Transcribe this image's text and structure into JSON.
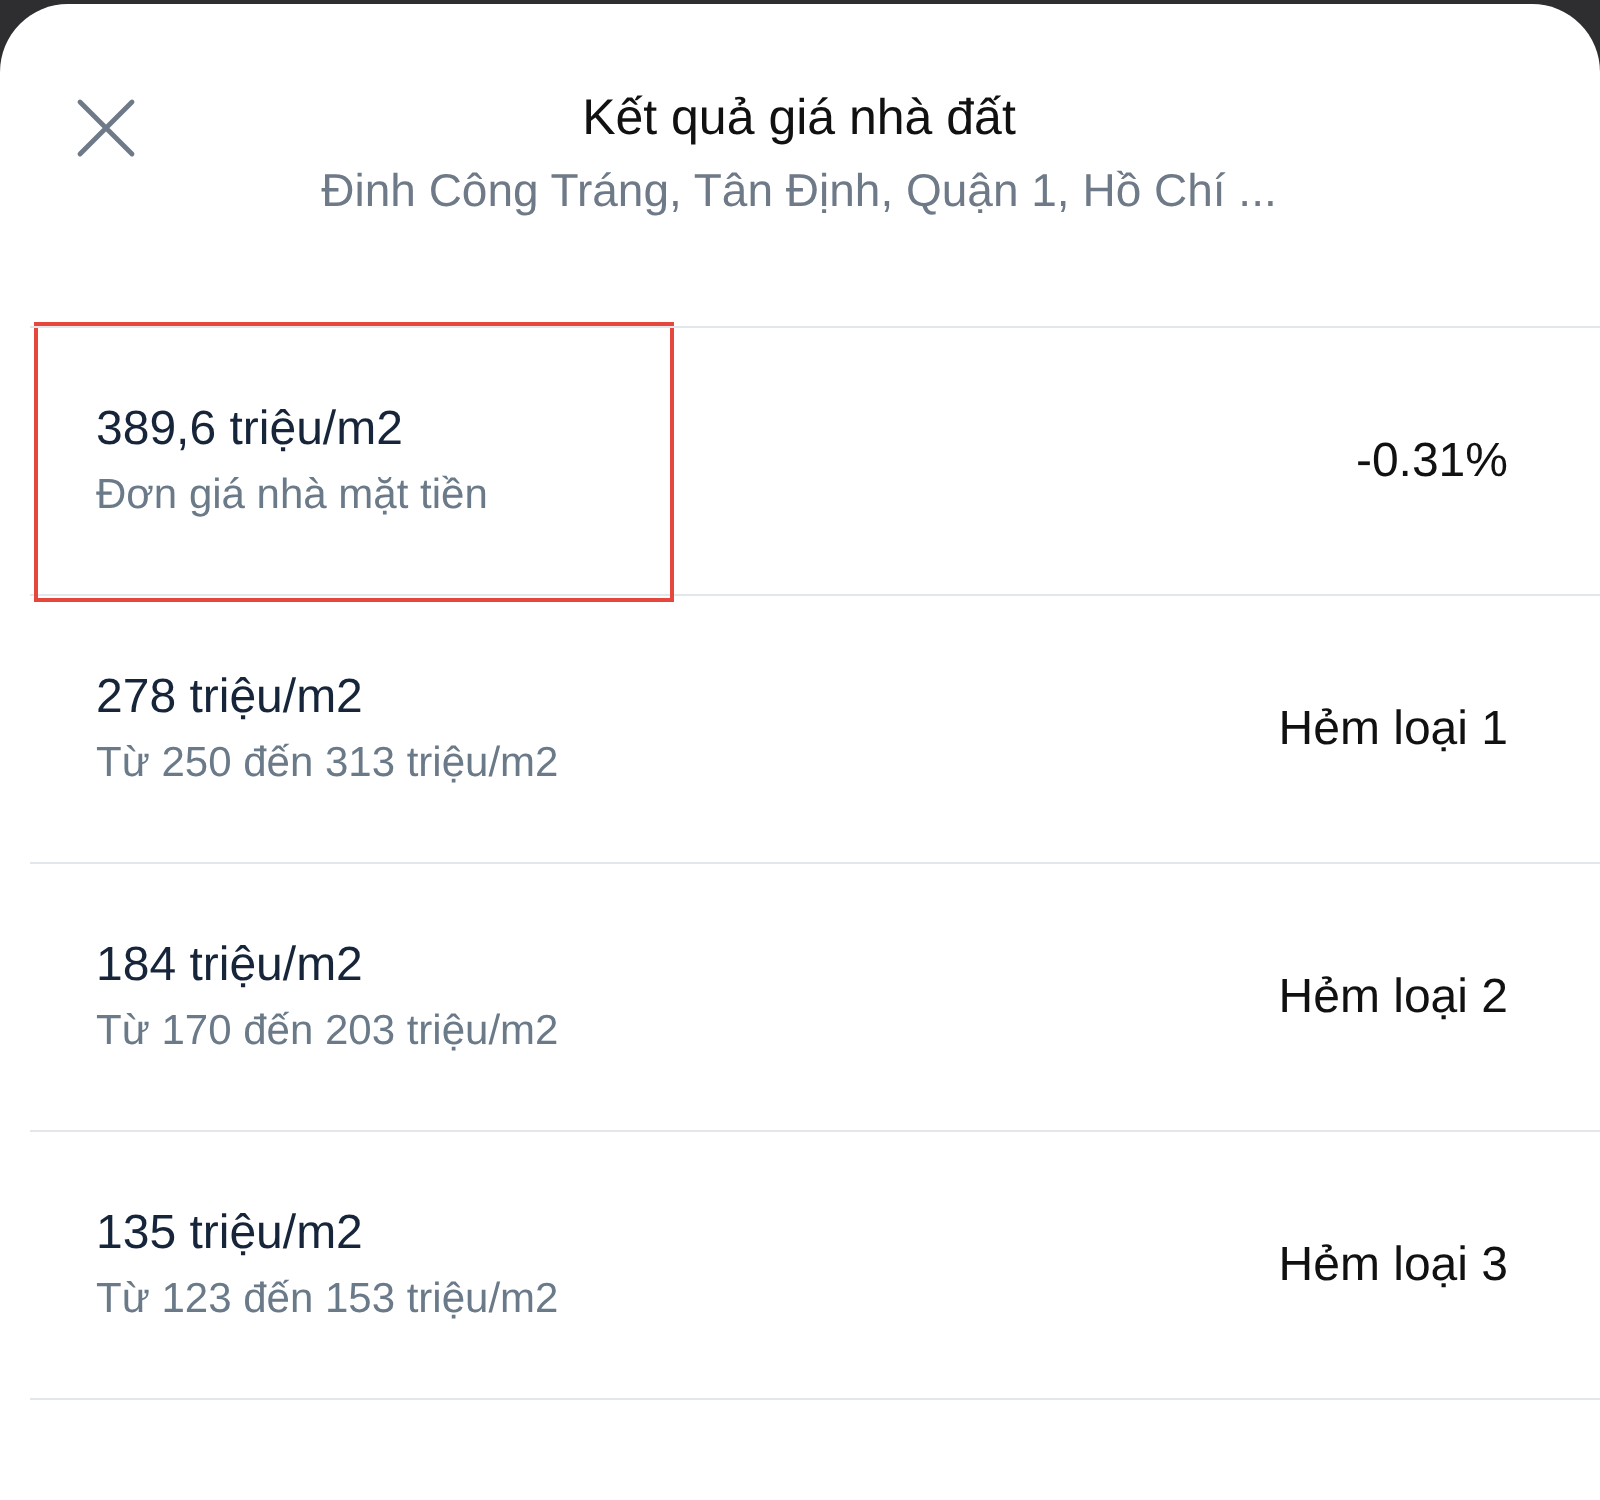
{
  "header": {
    "title": "Kết quả giá nhà đất",
    "subtitle": "Đinh Công Tráng, Tân Định, Quận 1, Hồ Chí ..."
  },
  "rows": [
    {
      "price": "389,6 triệu/m2",
      "detail": "Đơn giá nhà mặt tiền",
      "trailing": "-0.31%",
      "highlighted": true
    },
    {
      "price": "278 triệu/m2",
      "detail": "Từ 250 đến 313 triệu/m2",
      "trailing": "Hẻm loại 1",
      "highlighted": false
    },
    {
      "price": "184 triệu/m2",
      "detail": "Từ 170 đến 203 triệu/m2",
      "trailing": "Hẻm loại 2",
      "highlighted": false
    },
    {
      "price": "135 triệu/m2",
      "detail": "Từ 123 đến 153 triệu/m2",
      "trailing": "Hẻm loại 3",
      "highlighted": false
    }
  ]
}
